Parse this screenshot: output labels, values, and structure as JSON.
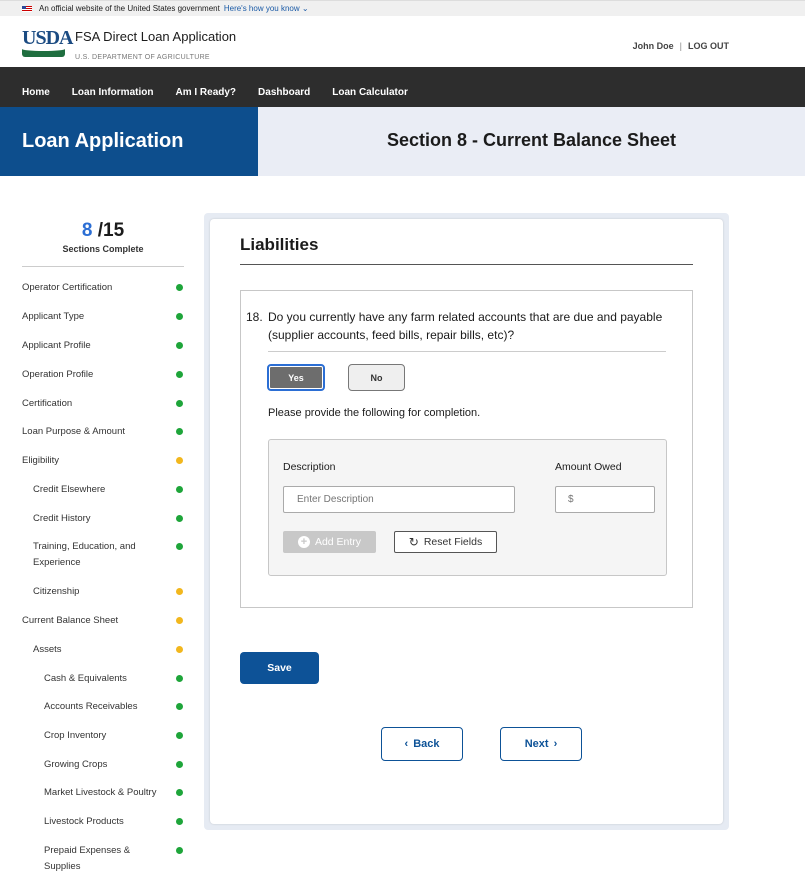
{
  "gov_banner": {
    "text": "An official website of the United States government",
    "link": "Here's how you know"
  },
  "header": {
    "logo_text": "USDA",
    "app_title": "FSA Direct Loan Application",
    "dept": "U.S. DEPARTMENT OF AGRICULTURE",
    "user_name": "John Doe",
    "separator": "|",
    "logout": "LOG OUT"
  },
  "nav": {
    "items": [
      "Home",
      "Loan Information",
      "Am I Ready?",
      "Dashboard",
      "Loan Calculator"
    ]
  },
  "title_band": {
    "left": "Loan Application",
    "right": "Section 8 - Current Balance Sheet"
  },
  "sidebar": {
    "progress_current": "8",
    "progress_total": "/15",
    "progress_label": "Sections Complete",
    "items": [
      {
        "label": "Operator Certification",
        "status": "complete",
        "color": "#1ea53a",
        "level": 0
      },
      {
        "label": "Applicant Type",
        "status": "complete",
        "color": "#1ea53a",
        "level": 0
      },
      {
        "label": "Applicant Profile",
        "status": "complete",
        "color": "#1ea53a",
        "level": 0
      },
      {
        "label": "Operation Profile",
        "status": "complete",
        "color": "#1ea53a",
        "level": 0
      },
      {
        "label": "Certification",
        "status": "complete",
        "color": "#1ea53a",
        "level": 0
      },
      {
        "label": "Loan Purpose & Amount",
        "status": "complete",
        "color": "#1ea53a",
        "level": 0
      },
      {
        "label": "Eligibility",
        "status": "in-progress",
        "color": "#f2b71d",
        "level": 0
      },
      {
        "label": "Credit Elsewhere",
        "status": "complete",
        "color": "#1ea53a",
        "level": 1
      },
      {
        "label": "Credit History",
        "status": "complete",
        "color": "#1ea53a",
        "level": 1
      },
      {
        "label": "Training, Education, and Experience",
        "status": "complete",
        "color": "#1ea53a",
        "level": 1
      },
      {
        "label": "Citizenship",
        "status": "in-progress",
        "color": "#f2b71d",
        "level": 1
      },
      {
        "label": "Current Balance Sheet",
        "status": "in-progress",
        "color": "#f2b71d",
        "level": 0
      },
      {
        "label": "Assets",
        "status": "in-progress",
        "color": "#f2b71d",
        "level": 1
      },
      {
        "label": "Cash & Equivalents",
        "status": "complete",
        "color": "#1ea53a",
        "level": 2
      },
      {
        "label": "Accounts Receivables",
        "status": "complete",
        "color": "#1ea53a",
        "level": 2
      },
      {
        "label": "Crop Inventory",
        "status": "complete",
        "color": "#1ea53a",
        "level": 2
      },
      {
        "label": "Growing Crops",
        "status": "complete",
        "color": "#1ea53a",
        "level": 2
      },
      {
        "label": "Market Livestock & Poultry",
        "status": "complete",
        "color": "#1ea53a",
        "level": 2
      },
      {
        "label": "Livestock Products",
        "status": "complete",
        "color": "#1ea53a",
        "level": 2
      },
      {
        "label": "Prepaid Expenses & Supplies",
        "status": "complete",
        "color": "#1ea53a",
        "level": 2
      }
    ]
  },
  "main": {
    "section_title": "Liabilities",
    "question": {
      "number": "18.",
      "text": "Do you currently have any farm related accounts that are due and payable (supplier accounts, feed bills, repair bills, etc)?",
      "yes_label": "Yes",
      "no_label": "No",
      "selected": "Yes",
      "hint": "Please provide the following for completion."
    },
    "entry": {
      "description_label": "Description",
      "amount_label": "Amount Owed",
      "description_value": "",
      "description_placeholder": "Enter Description",
      "amount_value": "",
      "amount_placeholder": "$",
      "add_label": "Add Entry",
      "reset_label": "Reset Fields"
    },
    "save_label": "Save",
    "back_label": "Back",
    "next_label": "Next"
  }
}
